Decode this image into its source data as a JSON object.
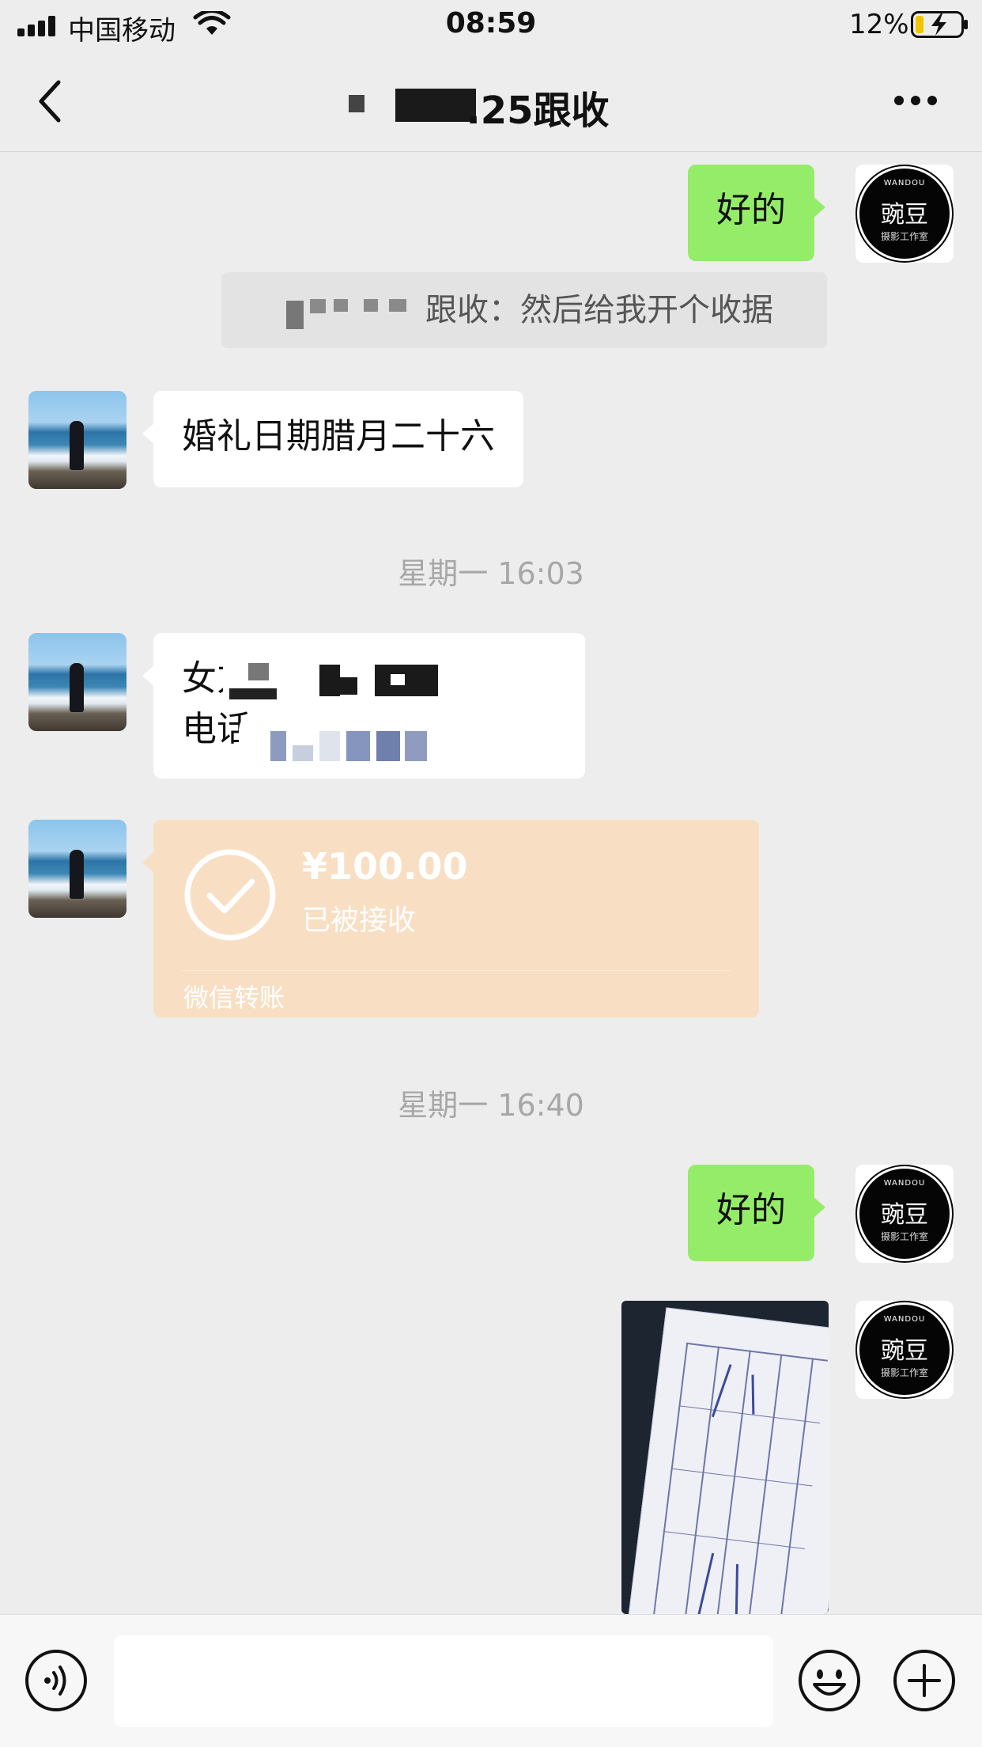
{
  "status_bar": {
    "carrier": "中国移动",
    "time": "08:59",
    "battery_percent": "12%",
    "battery_level": 0.12,
    "icons": [
      "signal-icon",
      "wifi-icon",
      "battery-charging-icon"
    ]
  },
  "header": {
    "title_visible": ".25跟收",
    "icons": [
      "back-icon",
      "more-icon"
    ]
  },
  "messages": [
    {
      "id": "m1",
      "side": "outgoing",
      "type": "text",
      "text": "好的"
    },
    {
      "id": "m2",
      "type": "quote",
      "text": "跟收：然后给我开个收据"
    },
    {
      "id": "m3",
      "side": "incoming",
      "type": "text",
      "text": "婚礼日期腊月二十六"
    },
    {
      "id": "t1",
      "type": "timestamp",
      "text": "星期一 16:03"
    },
    {
      "id": "m4",
      "side": "incoming",
      "type": "text",
      "line1": "女方",
      "line2_label": "电话：",
      "line2_value": "1"
    },
    {
      "id": "m5",
      "side": "incoming",
      "type": "transfer",
      "amount": "¥100.00",
      "status": "已被接收",
      "label": "微信转账"
    },
    {
      "id": "t2",
      "type": "timestamp",
      "text": "星期一 16:40"
    },
    {
      "id": "m6",
      "side": "outgoing",
      "type": "text",
      "text": "好的"
    },
    {
      "id": "m7",
      "side": "outgoing",
      "type": "image",
      "description": "receipt-photo"
    }
  ],
  "brand_avatar": {
    "top": "WANDOU",
    "name": "豌豆",
    "sub": "摄影工作室"
  },
  "input_bar": {
    "placeholder": "",
    "icons": [
      "voice-icon",
      "emoji-icon",
      "plus-icon"
    ]
  },
  "colors": {
    "background": "#ededed",
    "outgoing_bubble": "#95ec69",
    "incoming_bubble": "#ffffff",
    "transfer_card": "#f8dfc3",
    "timestamp_text": "#a7a7a7"
  }
}
